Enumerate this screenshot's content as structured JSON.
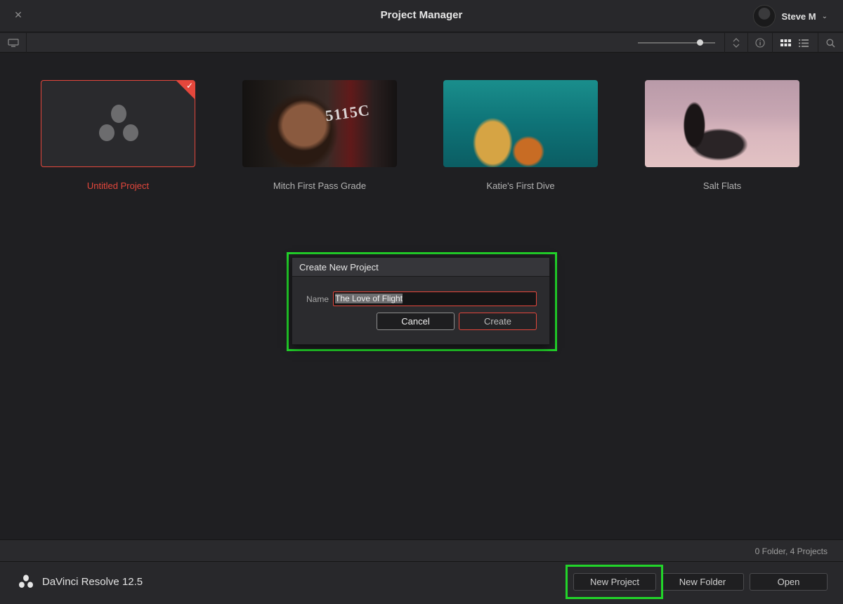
{
  "window": {
    "title": "Project Manager",
    "close_glyph": "✕",
    "user_name": "Steve M",
    "user_menu_glyph": "⌄"
  },
  "toolbar": {
    "icons": [
      "monitor-icon",
      "sort-icon",
      "info-icon",
      "grid-view-icon",
      "list-view-icon",
      "search-icon"
    ],
    "zoom_slider_value": 0.8
  },
  "projects": [
    {
      "name": "Untitled Project",
      "selected": true
    },
    {
      "name": "Mitch First Pass Grade",
      "overlay": "5115C"
    },
    {
      "name": "Katie's First Dive"
    },
    {
      "name": "Salt Flats"
    }
  ],
  "dialog": {
    "title": "Create New Project",
    "name_label": "Name",
    "name_value": "The Love of Flight",
    "cancel_label": "Cancel",
    "create_label": "Create"
  },
  "status": {
    "summary": "0 Folder, 4 Projects"
  },
  "footer": {
    "app_name": "DaVinci Resolve 12.5",
    "new_project_label": "New Project",
    "new_folder_label": "New Folder",
    "open_label": "Open"
  },
  "colors": {
    "accent": "#e4473c",
    "highlight": "#22d42a"
  }
}
